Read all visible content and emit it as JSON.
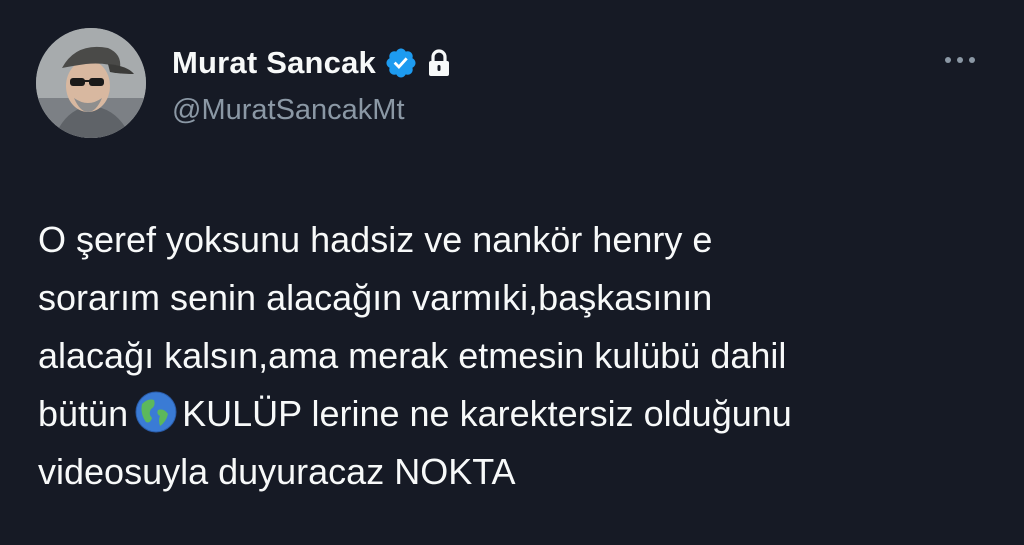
{
  "author": {
    "display_name": "Murat Sancak",
    "handle": "@MuratSancakMt",
    "verified": true,
    "protected": true,
    "avatar": "avatar-photo-man-cap-sunglasses"
  },
  "menu": {
    "icon": "more-horizontal-icon"
  },
  "tweet": {
    "lines": [
      "O şeref yoksunu hadsiz ve nankör henry e",
      "sorarım senin alacağın varmıki,başkasının",
      "alacağı kalsın,ama merak etmesin kulübü dahil",
      "bütün",
      "KULÜP lerine ne karektersiz olduğunu",
      "videosuyla duyuracaz NOKTA"
    ],
    "emoji": "globe-americas-icon"
  },
  "colors": {
    "background": "#161a25",
    "text": "#f7f9f9",
    "secondary_text": "#8b98a5",
    "verified_blue": "#1d9bf0"
  }
}
